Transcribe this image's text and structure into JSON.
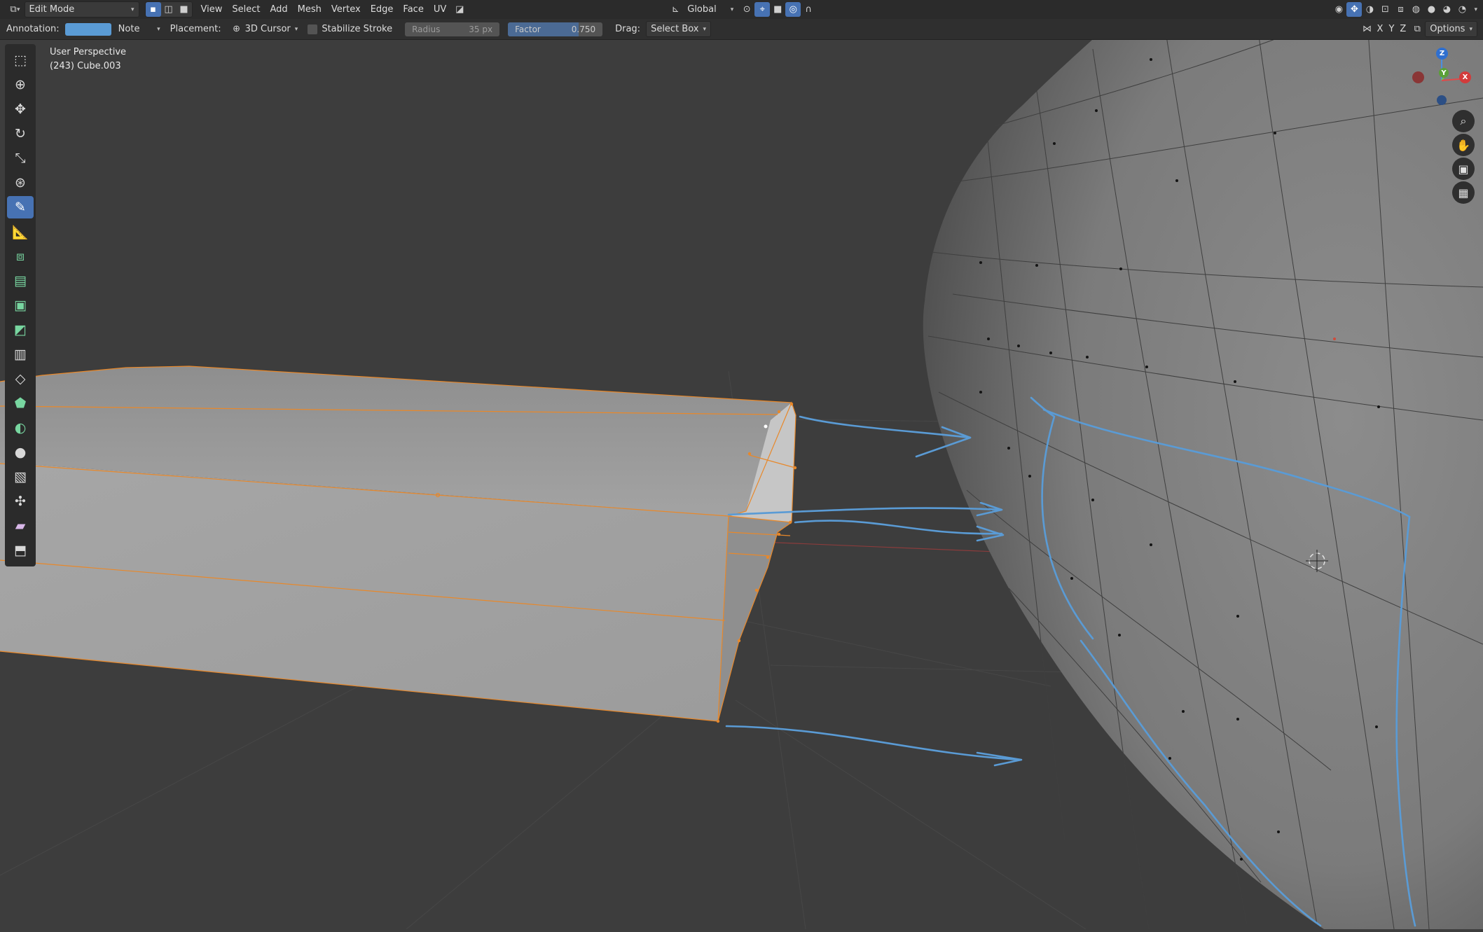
{
  "header": {
    "mode_label": "Edit Mode",
    "menus": [
      "View",
      "Select",
      "Add",
      "Mesh",
      "Vertex",
      "Edge",
      "Face",
      "UV"
    ],
    "orientation_label": "Global"
  },
  "toolsettings": {
    "annotation_label": "Annotation:",
    "annotation_color": "#5a9bd5",
    "note_label": "Note",
    "placement_label": "Placement:",
    "placement_value": "3D Cursor",
    "stabilize_label": "Stabilize Stroke",
    "radius_label": "Radius",
    "radius_value": "35 px",
    "factor_label": "Factor",
    "factor_value": "0.750",
    "factor_fraction": 0.75,
    "drag_label": "Drag:",
    "drag_value": "Select Box",
    "axes": [
      "X",
      "Y",
      "Z"
    ],
    "options_label": "Options"
  },
  "viewport": {
    "view_name": "User Perspective",
    "object_name": "(243) Cube.003",
    "colors": {
      "background": "#3d3d3d",
      "selection": "#e8882a",
      "annotation": "#5a9bd5",
      "mesh": "#9a9a9a"
    }
  },
  "gizmo": {
    "z": "Z",
    "y": "Y",
    "x": "X"
  },
  "toolbar": {
    "tools": [
      {
        "icon": "select-box-icon"
      },
      {
        "icon": "cursor-icon"
      },
      {
        "icon": "move-icon"
      },
      {
        "icon": "rotate-icon"
      },
      {
        "icon": "scale-icon"
      },
      {
        "icon": "transform-icon"
      },
      {
        "icon": "annotate-icon"
      },
      {
        "icon": "measure-icon"
      },
      {
        "icon": "add-cube-icon"
      },
      {
        "icon": "extrude-icon"
      },
      {
        "icon": "inset-icon"
      },
      {
        "icon": "bevel-icon"
      },
      {
        "icon": "loop-cut-icon"
      },
      {
        "icon": "knife-icon"
      },
      {
        "icon": "poly-build-icon"
      },
      {
        "icon": "spin-icon"
      },
      {
        "icon": "smooth-icon"
      },
      {
        "icon": "edge-slide-icon"
      },
      {
        "icon": "shrink-fatten-icon"
      },
      {
        "icon": "shear-icon"
      },
      {
        "icon": "rip-icon"
      }
    ]
  }
}
